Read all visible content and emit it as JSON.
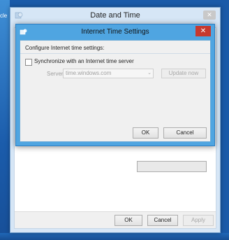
{
  "desktop": {
    "edge_text": "cle"
  },
  "outer_window": {
    "title": "Date and Time",
    "close_glyph": "✕",
    "app_icon": "date-time-app-icon",
    "buttons": {
      "ok": "OK",
      "cancel": "Cancel",
      "apply": "Apply"
    }
  },
  "dialog": {
    "title": "Internet Time Settings",
    "close_glyph": "✕",
    "app_icon": "internet-time-app-icon",
    "section_label": "Configure Internet time settings:",
    "sync_checkbox_label": "Synchronize with an Internet time server",
    "sync_checked": false,
    "server_label": "Server:",
    "server_value": "time.windows.com",
    "update_button": "Update now",
    "ok_button": "OK",
    "cancel_button": "Cancel"
  },
  "colors": {
    "dialog_frame": "#4fa5e1",
    "close_red": "#c7392e",
    "desktop_blue": "#1a5aa8"
  }
}
